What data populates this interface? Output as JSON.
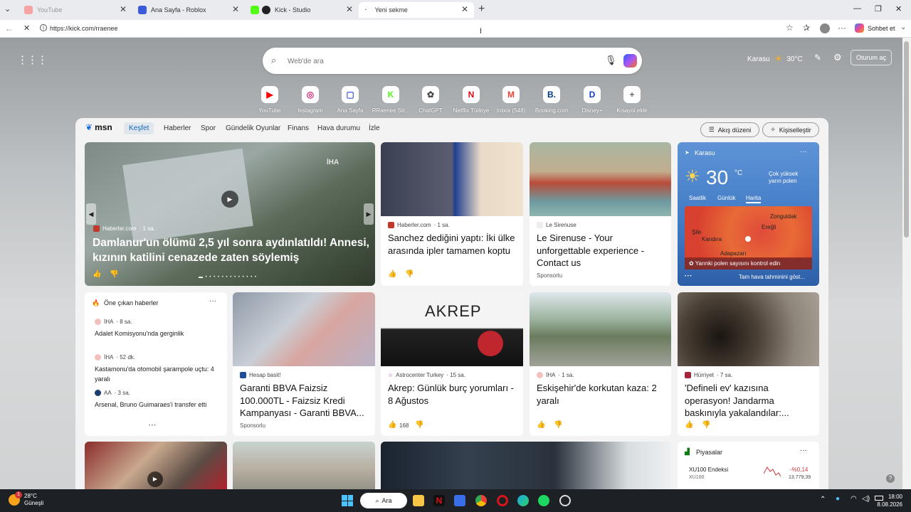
{
  "tabs": [
    {
      "label": "YouTube",
      "color": "#e66",
      "dim": true
    },
    {
      "label": "Ana Sayfa - Roblox",
      "color": "#3b5bdb",
      "dim": false
    },
    {
      "label": "Kick - Studio",
      "color": "#53fc18",
      "dim": false
    },
    {
      "label": "Yeni sekme",
      "color": "#999",
      "dim": false
    }
  ],
  "address": {
    "url": "https://kick.com/rraenee"
  },
  "toolbar": {
    "copilot_label": "Sohbet et"
  },
  "header": {
    "location": "Karasu",
    "temp": "30°C",
    "signin": "Oturum aç"
  },
  "search": {
    "placeholder": "Web'de ara"
  },
  "shortcuts": [
    {
      "label": "YouTube",
      "icon": "youtube-icon",
      "color": "#ff0000",
      "glyph": "▶"
    },
    {
      "label": "Instagram",
      "icon": "instagram-icon",
      "color": "#d62976",
      "glyph": "◎"
    },
    {
      "label": "Ana Sayfa",
      "icon": "roblox-icon",
      "color": "#3b5bdb",
      "glyph": "▢"
    },
    {
      "label": "RRaenee Str...",
      "icon": "kick-icon",
      "color": "#53fc18",
      "glyph": "K"
    },
    {
      "label": "ChatGPT",
      "icon": "chatgpt-icon",
      "color": "#444",
      "glyph": "✿"
    },
    {
      "label": "Netflix Türkiye",
      "icon": "netflix-icon",
      "color": "#e50914",
      "glyph": "N"
    },
    {
      "label": "Inbox (548)",
      "icon": "gmail-icon",
      "color": "#ea4335",
      "glyph": "M"
    },
    {
      "label": "Booking.com",
      "icon": "booking-icon",
      "color": "#003580",
      "glyph": "B."
    },
    {
      "label": "Disney+",
      "icon": "disney-icon",
      "color": "#113ccf",
      "glyph": "D"
    },
    {
      "label": "Kısayol ekle",
      "icon": "plus-icon",
      "color": "#666",
      "glyph": "+"
    }
  ],
  "msn": {
    "logo": "msn",
    "nav": [
      "Keşfet",
      "Haberler",
      "Spor",
      "Gündelik Oyunlar",
      "Finans",
      "Hava durumu",
      "İzle"
    ],
    "feed_btn": "Akış düzeni",
    "personalize_btn": "Kişiselleştir"
  },
  "hero": {
    "source": "Haberler.com",
    "time": "· 1 sa.",
    "title": "Damlanur'un ölümü 2,5 yıl sonra aydınlatıldı! Annesi, kızının katilini cenazede zaten söylemiş",
    "watermark": "İHA"
  },
  "card_sanchez": {
    "source": "Haberler.com",
    "time": "· 1 sa.",
    "title": "Sanchez dediğini yaptı: İki ülke arasında ipler tamamen koptu"
  },
  "card_sirenuse": {
    "source": "Le Sirenuse",
    "title": "Le Sirenuse - Your unforgettable experience - Contact us",
    "sponsored": "Sponsorlu"
  },
  "weather": {
    "location": "Karasu",
    "temp": "30",
    "unit": "°C",
    "alert": "Çok yüksek yarın polen",
    "tabs": [
      "Saatlik",
      "Günlük",
      "Harita"
    ],
    "map_labels": [
      "Zonguldak",
      "Ereğli",
      "Kandıra",
      "Adapazarı",
      "Şile"
    ],
    "pollen": "Yarınki polen sayısını kontrol edin",
    "forecast": "Tam hava tahminini göst..."
  },
  "top_news": {
    "header": "Öne çıkan haberler",
    "items": [
      {
        "source": "İHA",
        "time": "· 8 sa.",
        "title": "Adalet Komisyonu'nda gerginlik"
      },
      {
        "source": "İHA",
        "time": "· 52 dk.",
        "title": "Kastamonu'da otomobil şarampole uçtu: 4 yaralı"
      },
      {
        "source": "AA",
        "time": "· 3 sa.",
        "title": "Arsenal, Bruno Guimaraes'i transfer etti"
      }
    ]
  },
  "card_garanti": {
    "source": "Hesap basit!",
    "title": "Garanti BBVA Faizsiz 100.000TL - Faizsiz Kredi Kampanyası - Garanti BBVA...",
    "sponsored": "Sponsorlu"
  },
  "card_akrep": {
    "source": "Astrocenter Turkey",
    "time": "· 15 sa.",
    "title": "Akrep: Günlük burç yorumları - 8 Ağustos",
    "likes": "168",
    "img_text": "AKREP"
  },
  "card_eskisehir": {
    "source": "İHA",
    "time": "· 1 sa.",
    "title": "Eskişehir'de korkutan kaza: 2 yaralı"
  },
  "card_define": {
    "source": "Hürriyet",
    "time": "· 7 sa.",
    "title": "'Defineli ev' kazısına operasyon! Jandarma baskınıyla yakalandılar:..."
  },
  "markets": {
    "header": "Piyasalar",
    "name": "XU100 Endeksi",
    "sub": "XU100",
    "change": "-%0,14",
    "value": "13.779,39"
  },
  "taskbar": {
    "weather_temp": "28°C",
    "weather_desc": "Güneşli",
    "search": "Ara",
    "time": "18:00",
    "date": "8.08.2026",
    "badge": "1"
  },
  "colors": {
    "accent": "#0f6cbd",
    "negative": "#d13438"
  }
}
